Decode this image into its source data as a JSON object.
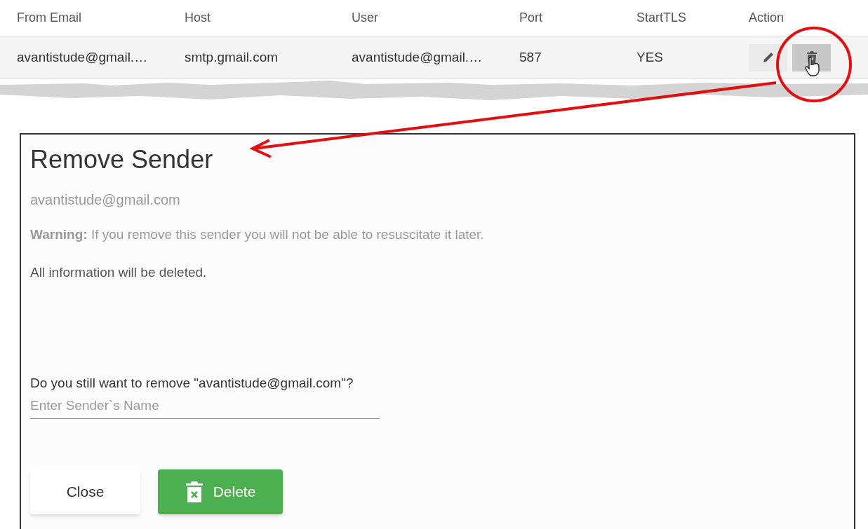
{
  "table": {
    "columns": [
      "From Email",
      "Host",
      "User",
      "Port",
      "StartTLS",
      "Action"
    ],
    "rows": [
      {
        "cells": [
          "avantistude@gmail.…",
          "smtp.gmail.com",
          "avantistude@gmail.…",
          "587",
          "YES"
        ],
        "actions": [
          {
            "kind": "edit",
            "hovered": false
          },
          {
            "kind": "delete",
            "hovered": true
          }
        ]
      }
    ]
  },
  "dialog": {
    "title": "Remove Sender",
    "email": "avantistude@gmail.com",
    "warning": "**Warning:** If you remove this sender you will not be able to resuscitate it later.",
    "note": "All information will be deleted.",
    "question": "Do you still want to remove \"avantistude@gmail.com\"?",
    "input": {
      "placeholder": "Enter Sender`s Name"
    },
    "buttons": [
      {
        "label": "Close",
        "kind": "secondary"
      },
      {
        "label": "Delete",
        "kind": "danger"
      }
    ]
  }
}
